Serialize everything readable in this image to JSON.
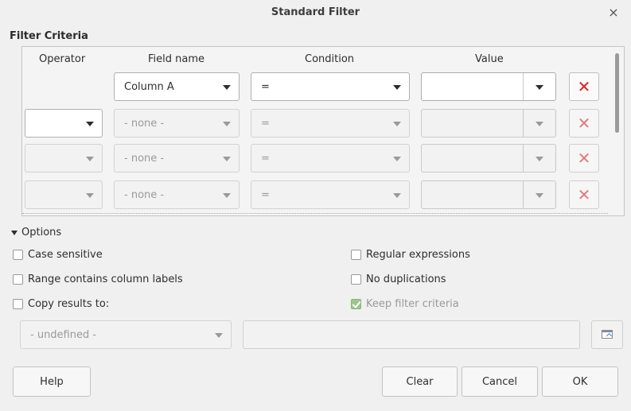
{
  "window": {
    "title": "Standard Filter",
    "close_glyph": "×"
  },
  "filter_criteria": {
    "section_title": "Filter Criteria",
    "columns": {
      "operator": "Operator",
      "field_name": "Field name",
      "condition": "Condition",
      "value": "Value"
    },
    "rows": [
      {
        "operator": "",
        "field_name": "Column A",
        "condition": "=",
        "value": "",
        "remove": "✕"
      },
      {
        "operator": "",
        "field_name": "- none -",
        "condition": "=",
        "value": "",
        "remove": "✕"
      },
      {
        "operator": "",
        "field_name": "- none -",
        "condition": "=",
        "value": "",
        "remove": "✕"
      },
      {
        "operator": "",
        "field_name": "- none -",
        "condition": "=",
        "value": "",
        "remove": "✕"
      }
    ]
  },
  "options": {
    "header": "Options",
    "case_sensitive": "Case sensitive",
    "range_labels": "Range contains column labels",
    "copy_results": "Copy results to:",
    "regex": "Regular expressions",
    "no_duplications": "No duplications",
    "keep_criteria": "Keep filter criteria",
    "copy_target": "- undefined -"
  },
  "buttons": {
    "help": "Help",
    "clear": "Clear",
    "cancel": "Cancel",
    "ok": "OK"
  },
  "colors": {
    "remove_active": "#e02020",
    "remove_disabled": "#e07c7c",
    "check_green": "#9ec48f"
  }
}
